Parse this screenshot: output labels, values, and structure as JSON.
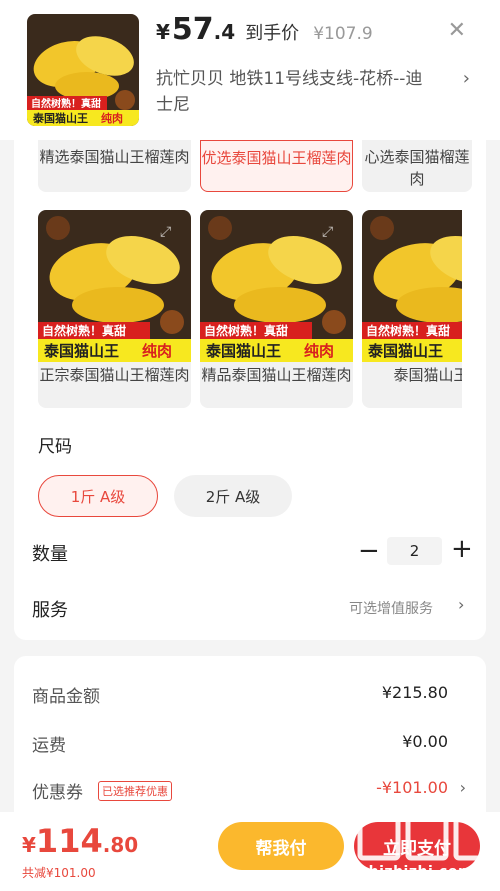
{
  "header": {
    "price_yen": "¥",
    "price_int": "57",
    "price_dec": ".4",
    "price_tag": "到手价",
    "price_original": "¥107.9",
    "address": "抗忙贝贝  地铁11号线支线-花桥--迪士尼",
    "product_banner_top": "自然树熟！真甜",
    "product_banner_bottom_a": "泰国猫山王",
    "product_banner_bottom_b": "纯肉"
  },
  "variants_row1": [
    {
      "name": "精选泰国猫山王榴莲肉",
      "selected": false
    },
    {
      "name": "优选泰国猫山王榴莲肉",
      "selected": true
    },
    {
      "name": "心选泰国猫榴莲肉",
      "selected": false
    }
  ],
  "variants_row2": [
    {
      "name": "正宗泰国猫山王榴莲肉"
    },
    {
      "name": "精品泰国猫山王榴莲肉"
    },
    {
      "name": "泰国猫山王肉"
    }
  ],
  "image_banner": {
    "top": "自然树熟！真甜",
    "bottom_a": "泰国猫山王",
    "bottom_b": "纯肉",
    "bottom_c": "泰国猫山王"
  },
  "size": {
    "title": "尺码",
    "options": [
      "1斤    A级",
      "2斤    A级"
    ],
    "selected_index": 0
  },
  "quantity": {
    "label": "数量",
    "value": "2",
    "minus": "−",
    "plus": "+"
  },
  "service": {
    "label": "服务",
    "value": "可选增值服务",
    "arrow": "›"
  },
  "summary": {
    "goods_label": "商品金额",
    "goods_value": "¥215.80",
    "shipping_label": "运费",
    "shipping_value": "¥0.00",
    "coupon_label": "优惠券",
    "coupon_tag": "已选推荐优惠",
    "coupon_value": "-¥101.00",
    "arrow": "›"
  },
  "footer": {
    "total_yen": "¥",
    "total_int": "114",
    "total_dec": ".80",
    "saved": "共减¥101.00",
    "help_pay": "帮我付",
    "pay": "立即支付"
  },
  "watermark": "zhizhizhi.com",
  "icons": {
    "close": "close-icon",
    "arrow": "chevron-right-icon",
    "expand": "expand-icon"
  },
  "colors": {
    "accent": "#e8483d",
    "pay_button": "#e8363a",
    "help_button": "#fbb82d",
    "durian_yellow": "#f2c62b"
  }
}
